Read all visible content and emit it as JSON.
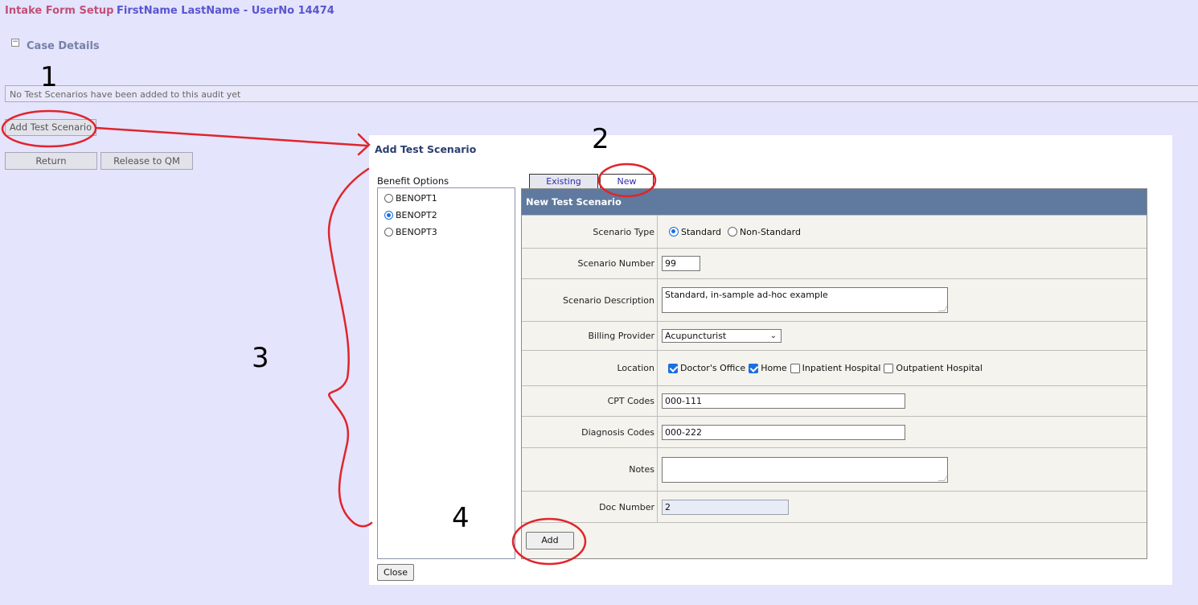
{
  "header": {
    "app_title": "Intake Form Setup",
    "user_info": "FirstName LastName - UserNo 14474"
  },
  "case_section": {
    "title": "Case Details",
    "collapse_glyph": "−",
    "empty_message": "No Test Scenarios have been added to this audit yet"
  },
  "buttons": {
    "add_test_scenario": "Add Test Scenario",
    "return": "Return",
    "release_to_qm": "Release to QM"
  },
  "dialog": {
    "title": "Add Test Scenario",
    "benefit_options_label": "Benefit Options",
    "benefit_options": [
      {
        "label": "BENOPT1",
        "selected": false
      },
      {
        "label": "BENOPT2",
        "selected": true
      },
      {
        "label": "BENOPT3",
        "selected": false
      }
    ],
    "tabs": [
      {
        "label": "Existing",
        "active": false
      },
      {
        "label": "New",
        "active": true
      }
    ],
    "form_header": "New Test Scenario",
    "fields": {
      "scenario_type": {
        "label": "Scenario Type",
        "options": [
          "Standard",
          "Non-Standard"
        ],
        "selected": "Standard"
      },
      "scenario_number": {
        "label": "Scenario Number",
        "value": "99"
      },
      "scenario_description": {
        "label": "Scenario Description",
        "value": "Standard, in-sample ad-hoc example"
      },
      "billing_provider": {
        "label": "Billing Provider",
        "value": "Acupuncturist"
      },
      "location": {
        "label": "Location",
        "options": [
          {
            "label": "Doctor's Office",
            "checked": true
          },
          {
            "label": "Home",
            "checked": true
          },
          {
            "label": "Inpatient Hospital",
            "checked": false
          },
          {
            "label": "Outpatient Hospital",
            "checked": false
          }
        ]
      },
      "cpt_codes": {
        "label": "CPT Codes",
        "value": "000-111"
      },
      "diagnosis_codes": {
        "label": "Diagnosis Codes",
        "value": "000-222"
      },
      "notes": {
        "label": "Notes",
        "value": ""
      },
      "doc_number": {
        "label": "Doc Number",
        "value": "2"
      }
    },
    "add_button": "Add",
    "close_button": "Close"
  },
  "annotations": {
    "labels": [
      "1",
      "2",
      "3",
      "4"
    ],
    "color": "#e0252b"
  },
  "colors": {
    "background": "#e4e4fc",
    "app_title": "#c0507a",
    "user_info": "#5a55d0",
    "form_header": "#5f7a9e",
    "accent": "#1a6fe0"
  }
}
